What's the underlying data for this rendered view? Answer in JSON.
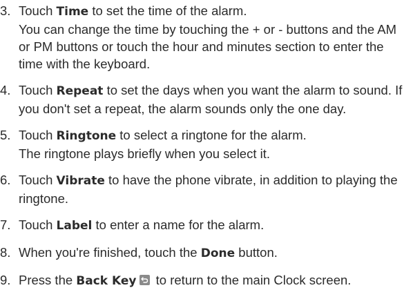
{
  "steps": [
    {
      "number": "3.",
      "before": "Touch ",
      "keyword": "Time",
      "after": " to set the time of the alarm.",
      "extra": "You can change the time by touching the + or - buttons and the AM or PM buttons or touch the hour and minutes section to enter the time with the keyboard."
    },
    {
      "number": "4.",
      "before": "Touch ",
      "keyword": "Repeat",
      "after": " to set the days when you want the alarm to sound. If you don't set a repeat, the alarm sounds only the one day."
    },
    {
      "number": "5.",
      "before": "Touch ",
      "keyword": "Ringtone",
      "after": " to select a ringtone for the alarm.",
      "extra": "The ringtone plays briefly when you select it."
    },
    {
      "number": "6.",
      "before": "Touch ",
      "keyword": "Vibrate",
      "after": " to have the phone vibrate, in addition to playing the ringtone."
    },
    {
      "number": "7.",
      "before": "Touch ",
      "keyword": "Label",
      "after": " to enter a name for the alarm."
    },
    {
      "number": "8.",
      "before": "When you're finished, touch the ",
      "keyword": "Done",
      "after": " button."
    },
    {
      "number": "9.",
      "before": "Press the ",
      "keyword": "Back Key",
      "icon": "back-arrow-icon",
      "after": " to return to the main Clock screen."
    }
  ]
}
